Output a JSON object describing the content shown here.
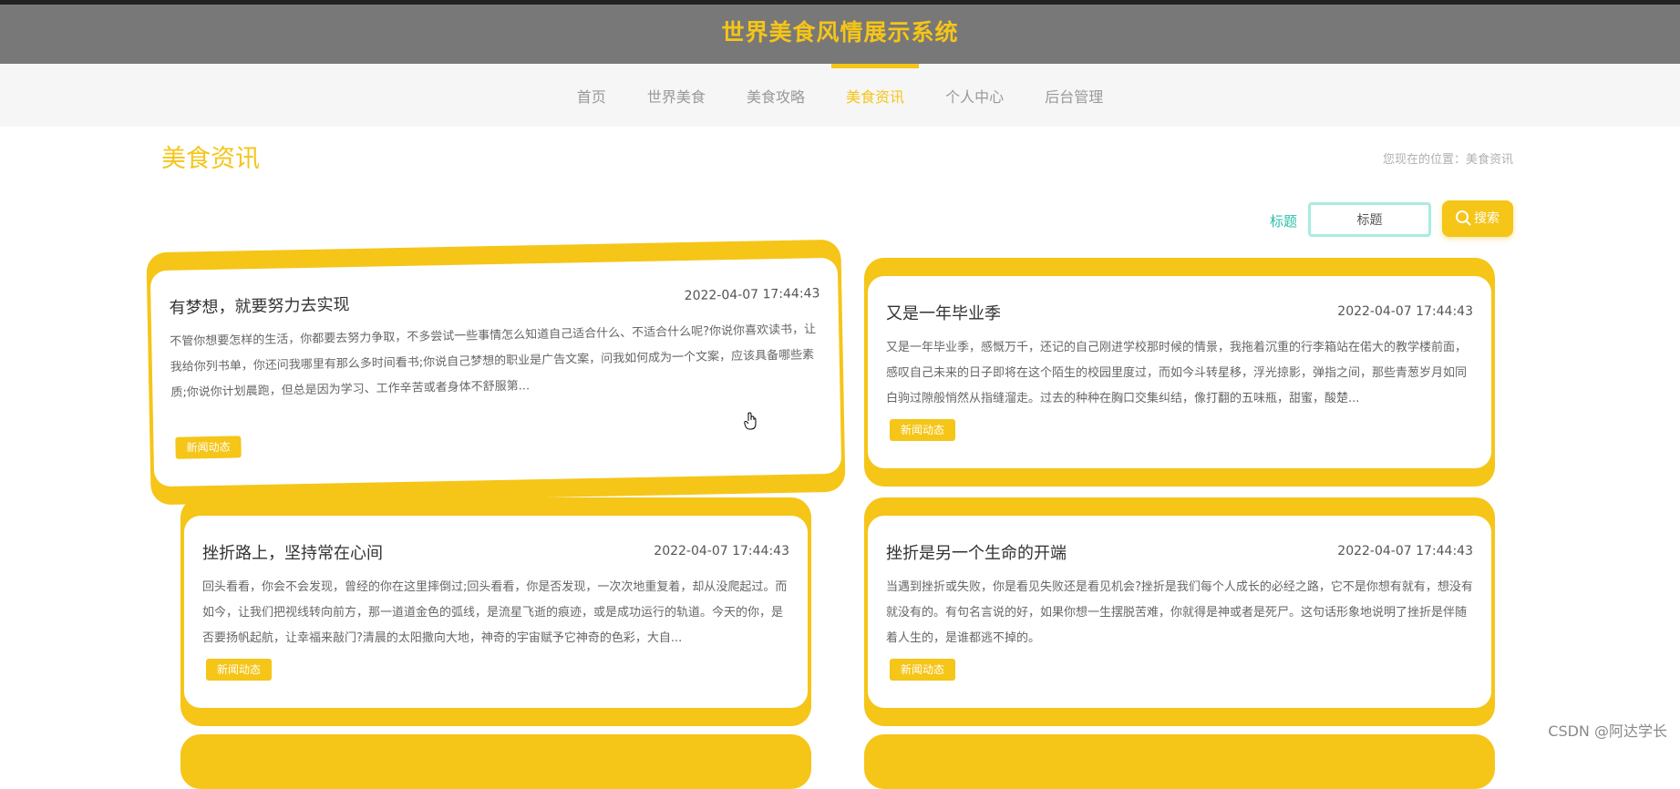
{
  "header": {
    "title": "世界美食风情展示系统"
  },
  "nav": [
    {
      "label": "首页"
    },
    {
      "label": "世界美食"
    },
    {
      "label": "美食攻略"
    },
    {
      "label": "美食资讯",
      "active": true
    },
    {
      "label": "个人中心"
    },
    {
      "label": "后台管理"
    }
  ],
  "page": {
    "title": "美食资讯",
    "breadcrumb_prefix": "您现在的位置：",
    "breadcrumb_current": "美食资讯"
  },
  "search": {
    "label": "标题",
    "value": "标题",
    "button": "搜索"
  },
  "cards": [
    {
      "title": "有梦想，就要努力去实现",
      "date": "2022-04-07 17:44:43",
      "body": "不管你想要怎样的生活，你都要去努力争取，不多尝试一些事情怎么知道自己适合什么、不适合什么呢?你说你喜欢读书，让我给你列书单，你还问我哪里有那么多时间看书;你说自己梦想的职业是广告文案，问我如何成为一个文案，应该具备哪些素质;你说你计划晨跑，但总是因为学习、工作辛苦或者身体不舒服第...",
      "tag": "新闻动态"
    },
    {
      "title": "又是一年毕业季",
      "date": "2022-04-07 17:44:43",
      "body": "又是一年毕业季，感慨万千，还记的自己刚进学校那时候的情景，我拖着沉重的行李箱站在偌大的教学楼前面，感叹自己未来的日子即将在这个陌生的校园里度过，而如今斗转星移，浮光掠影，弹指之间，那些青葱岁月如同白驹过隙般悄然从指缝溜走。过去的种种在胸口交集纠结，像打翻的五味瓶，甜蜜，酸楚...",
      "tag": "新闻动态"
    },
    {
      "title": "挫折路上，坚持常在心间",
      "date": "2022-04-07 17:44:43",
      "body": "回头看看，你会不会发现，曾经的你在这里摔倒过;回头看看，你是否发现，一次次地重复着，却从没爬起过。而如今，让我们把视线转向前方，那一道道金色的弧线，是流星飞逝的痕迹，或是成功运行的轨道。今天的你，是否要扬帆起航，让幸福来敲门?清晨的太阳撒向大地，神奇的宇宙赋予它神奇的色彩，大自...",
      "tag": "新闻动态"
    },
    {
      "title": "挫折是另一个生命的开端",
      "date": "2022-04-07 17:44:43",
      "body": "当遇到挫折或失败，你是看见失败还是看见机会?挫折是我们每个人成长的必经之路，它不是你想有就有，想没有就没有的。有句名言说的好，如果你想一生摆脱苦难，你就得是神或者是死尸。这句话形象地说明了挫折是伴随着人生的，是谁都逃不掉的。",
      "tag": "新闻动态"
    }
  ],
  "watermark": "CSDN @阿达学长",
  "colors": {
    "accent": "#f5c518",
    "header_bg": "#787878",
    "teal": "#2bbfa8"
  }
}
